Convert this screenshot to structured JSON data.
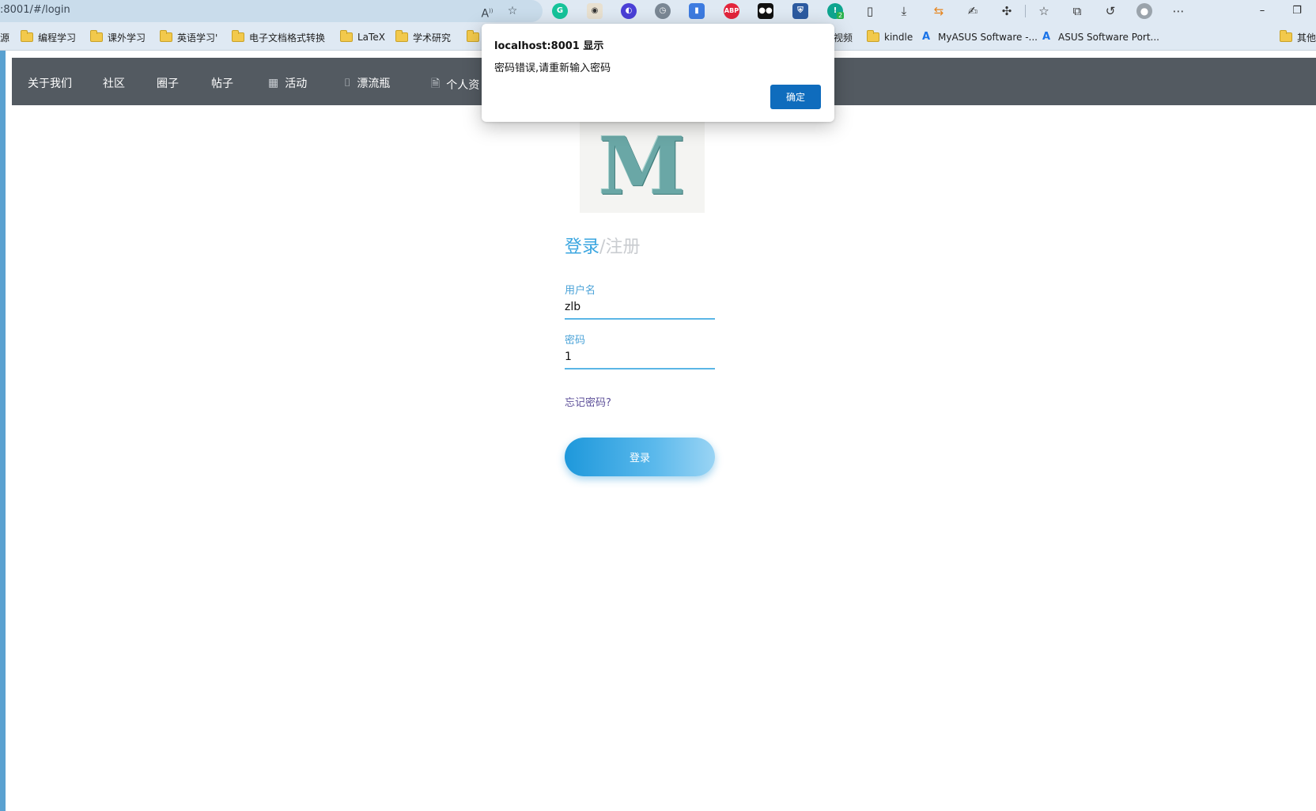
{
  "browser": {
    "url": ":8001/#/login",
    "bookmarks": [
      {
        "label": "源",
        "type": "text"
      },
      {
        "label": "编程学习",
        "type": "folder"
      },
      {
        "label": "课外学习",
        "type": "folder"
      },
      {
        "label": "英语学习'",
        "type": "folder"
      },
      {
        "label": "电子文档格式转换",
        "type": "folder"
      },
      {
        "label": "LaTeX",
        "type": "folder"
      },
      {
        "label": "学术研究",
        "type": "folder"
      },
      {
        "label": "视频",
        "type": "text"
      },
      {
        "label": "kindle",
        "type": "folder"
      },
      {
        "label": "MyASUS Software -...",
        "type": "asus"
      },
      {
        "label": "ASUS Software Port...",
        "type": "asus"
      },
      {
        "label": "其他",
        "type": "folder"
      }
    ],
    "extension_badges": {
      "grammarly_count": "2"
    }
  },
  "navbar": {
    "items": [
      {
        "label": "关于我们",
        "icon": ""
      },
      {
        "label": "社区",
        "icon": ""
      },
      {
        "label": "圈子",
        "icon": ""
      },
      {
        "label": "帖子",
        "icon": ""
      },
      {
        "label": "活动",
        "icon": "grid-icon"
      },
      {
        "label": "漂流瓶",
        "icon": "bottle-icon"
      },
      {
        "label": "个人资",
        "icon": "document-icon"
      }
    ]
  },
  "logo": {
    "letter": "M"
  },
  "auth": {
    "login_tab": "登录",
    "separator": "/",
    "register_tab": "注册",
    "username_label": "用户名",
    "username_value": "zlb",
    "password_label": "密码",
    "password_value": "1",
    "forgot_link": "忘记密码?",
    "submit_label": "登录"
  },
  "dialog": {
    "title": "localhost:8001 显示",
    "message": "密码错误,请重新输入密码",
    "ok_label": "确定"
  },
  "colors": {
    "navbar_bg": "#535a61",
    "accent": "#3ba6e0",
    "dialog_button": "#0f6cbd"
  }
}
